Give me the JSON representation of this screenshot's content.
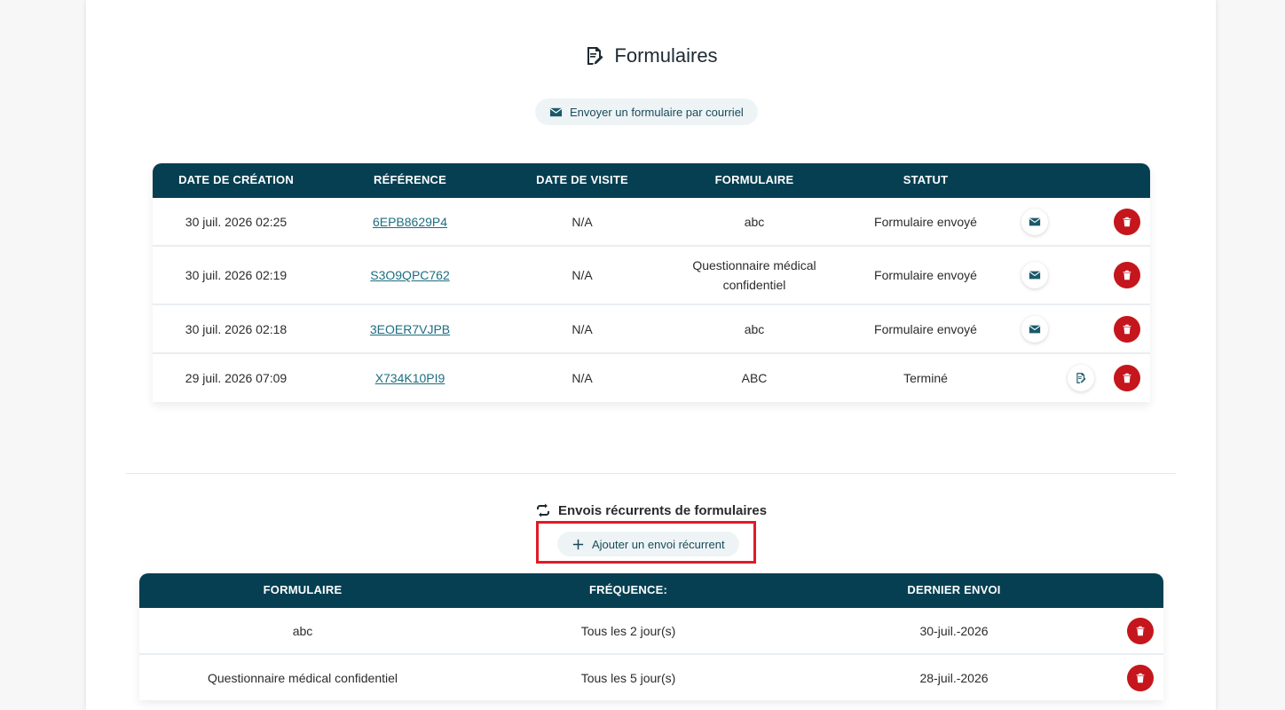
{
  "forms_section": {
    "title": "Formulaires",
    "send_button_label": "Envoyer un formulaire par courriel",
    "columns": [
      "DATE DE CRÉATION",
      "RÉFÉRENCE",
      "DATE DE VISITE",
      "FORMULAIRE",
      "STATUT"
    ],
    "rows": [
      {
        "created": "30 juil. 2026 02:25",
        "reference": "6EPB8629P4",
        "visit_date": "N/A",
        "form": "abc",
        "status": "Formulaire envoyé"
      },
      {
        "created": "30 juil. 2026 02:19",
        "reference": "S3O9QPC762",
        "visit_date": "N/A",
        "form": "Questionnaire médical confidentiel",
        "status": "Formulaire envoyé"
      },
      {
        "created": "30 juil. 2026 02:18",
        "reference": "3EOER7VJPB",
        "visit_date": "N/A",
        "form": "abc",
        "status": "Formulaire envoyé"
      },
      {
        "created": "29 juil. 2026 07:09",
        "reference": "X734K10PI9",
        "visit_date": "N/A",
        "form": "ABC",
        "status": "Terminé"
      }
    ]
  },
  "recurring_section": {
    "title": "Envois récurrents de formulaires",
    "add_button_label": "Ajouter un envoi récurrent",
    "columns": [
      "FORMULAIRE",
      "FRÉQUENCE:",
      "DERNIER ENVOI"
    ],
    "rows": [
      {
        "form": "abc",
        "frequency": "Tous les 2 jour(s)",
        "last_sent": "30-juil.-2026"
      },
      {
        "form": "Questionnaire médical confidentiel",
        "frequency": "Tous les 5 jour(s)",
        "last_sent": "28-juil.-2026"
      }
    ]
  },
  "colors": {
    "header_bg": "#063f52",
    "link": "#1d6e80",
    "delete": "#c4161c",
    "highlight": "#e01b24"
  }
}
